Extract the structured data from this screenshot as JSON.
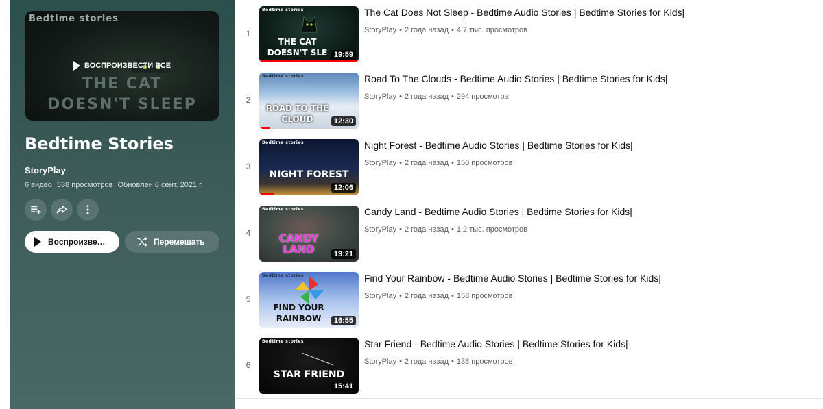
{
  "playlist": {
    "cover": {
      "brand": "Bedtime stories",
      "title_line1": "The Cat",
      "title_line2": "Doesn't Sleep",
      "play_all_label": "ВОСПРОИЗВЕСТИ ВСЕ"
    },
    "title": "Bedtime Stories",
    "owner": "StoryPlay",
    "video_count": "6 видео",
    "views": "538 просмотров",
    "updated": "Обновлен 6 сент. 2021 г.",
    "play_label": "Воспроизвести",
    "shuffle_label": "Перемешать"
  },
  "videos": [
    {
      "index": "1",
      "title": "The Cat Does Not Sleep - Bedtime Audio Stories | Bedtime Stories for Kids|",
      "channel": "StoryPlay",
      "age": "2 года назад",
      "views": "4,7 тыс. просмотров",
      "duration": "19:59",
      "thumb_brand": "Bedtime stories",
      "thumb_title": "The cat doesn't sle",
      "watched_fraction": 1.0
    },
    {
      "index": "2",
      "title": "Road To The Clouds - Bedtime Audio Stories | Bedtime Stories for Kids|",
      "channel": "StoryPlay",
      "age": "2 года назад",
      "views": "294 просмотра",
      "duration": "12:30",
      "thumb_brand": "Bedtime stories",
      "thumb_title": "Road to the cloud",
      "watched_fraction": 0.1
    },
    {
      "index": "3",
      "title": "Night Forest - Bedtime Audio Stories | Bedtime Stories for Kids|",
      "channel": "StoryPlay",
      "age": "2 года назад",
      "views": "150 просмотров",
      "duration": "12:06",
      "thumb_brand": "Bedtime stories",
      "thumb_title": "Night Forest",
      "watched_fraction": 0.15
    },
    {
      "index": "4",
      "title": "Candy Land - Bedtime Audio Stories | Bedtime Stories for Kids|",
      "channel": "StoryPlay",
      "age": "2 года назад",
      "views": "1,2 тыс. просмотров",
      "duration": "19:21",
      "thumb_brand": "Bedtime stories",
      "thumb_title": "Candy Land",
      "watched_fraction": 0
    },
    {
      "index": "5",
      "title": "Find Your Rainbow - Bedtime Audio Stories | Bedtime Stories for Kids|",
      "channel": "StoryPlay",
      "age": "2 года назад",
      "views": "158 просмотров",
      "duration": "16:55",
      "thumb_brand": "Bedtime stories",
      "thumb_title": "Find your rainbow",
      "watched_fraction": 0
    },
    {
      "index": "6",
      "title": "Star Friend - Bedtime Audio Stories | Bedtime Stories for Kids|",
      "channel": "StoryPlay",
      "age": "2 года назад",
      "views": "138 просмотров",
      "duration": "15:41",
      "thumb_brand": "Bedtime stories",
      "thumb_title": "Star Friend",
      "watched_fraction": 0
    }
  ],
  "meta_separator": "•",
  "colors": {
    "panel_bg": "#3b5a58",
    "progress": "#ff0000"
  }
}
